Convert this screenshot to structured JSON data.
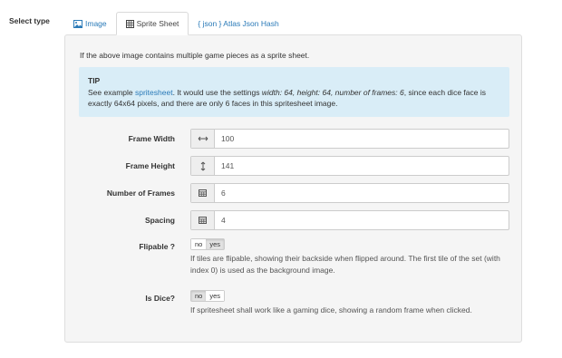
{
  "select_type_label": "Select type",
  "tabs": [
    {
      "label": "Image",
      "icon": "image-icon"
    },
    {
      "label": "Sprite Sheet",
      "icon": "grid-icon"
    },
    {
      "label": "{ json } Atlas Json Hash",
      "icon": ""
    }
  ],
  "active_tab": "Sprite Sheet",
  "intro": "If the above image contains multiple game pieces as a sprite sheet.",
  "tip": {
    "title": "TIP",
    "prefix": "See example ",
    "link": "spritesheet",
    "middle": ". It would use the settings ",
    "settings": "width: 64, height: 64, number of frames: 6",
    "suffix": ", since each dice face is exactly 64x64 pixels, and there are only 6 faces in this spritesheet image."
  },
  "fields": {
    "frame_width": {
      "label": "Frame Width",
      "value": "100",
      "icon": "horizontal-arrows-icon"
    },
    "frame_height": {
      "label": "Frame Height",
      "value": "141",
      "icon": "vertical-arrows-icon"
    },
    "number_of_frames": {
      "label": "Number of Frames",
      "value": "6",
      "icon": "table-icon"
    },
    "spacing": {
      "label": "Spacing",
      "value": "4",
      "icon": "table-icon"
    }
  },
  "flipable": {
    "label": "Flipable ?",
    "no": "no",
    "yes": "yes",
    "selected": "yes",
    "help": "If tiles are flipable, showing their backside when flipped around. The first tile of the set (with index 0) is used as the background image."
  },
  "is_dice": {
    "label": "Is Dice?",
    "no": "no",
    "yes": "yes",
    "selected": "no",
    "help": "If spritesheet shall work like a gaming dice, showing a random frame when clicked."
  },
  "colors": {
    "link": "#2a7ab8",
    "tip_background": "#d9edf7",
    "panel_background": "#f5f5f5"
  }
}
